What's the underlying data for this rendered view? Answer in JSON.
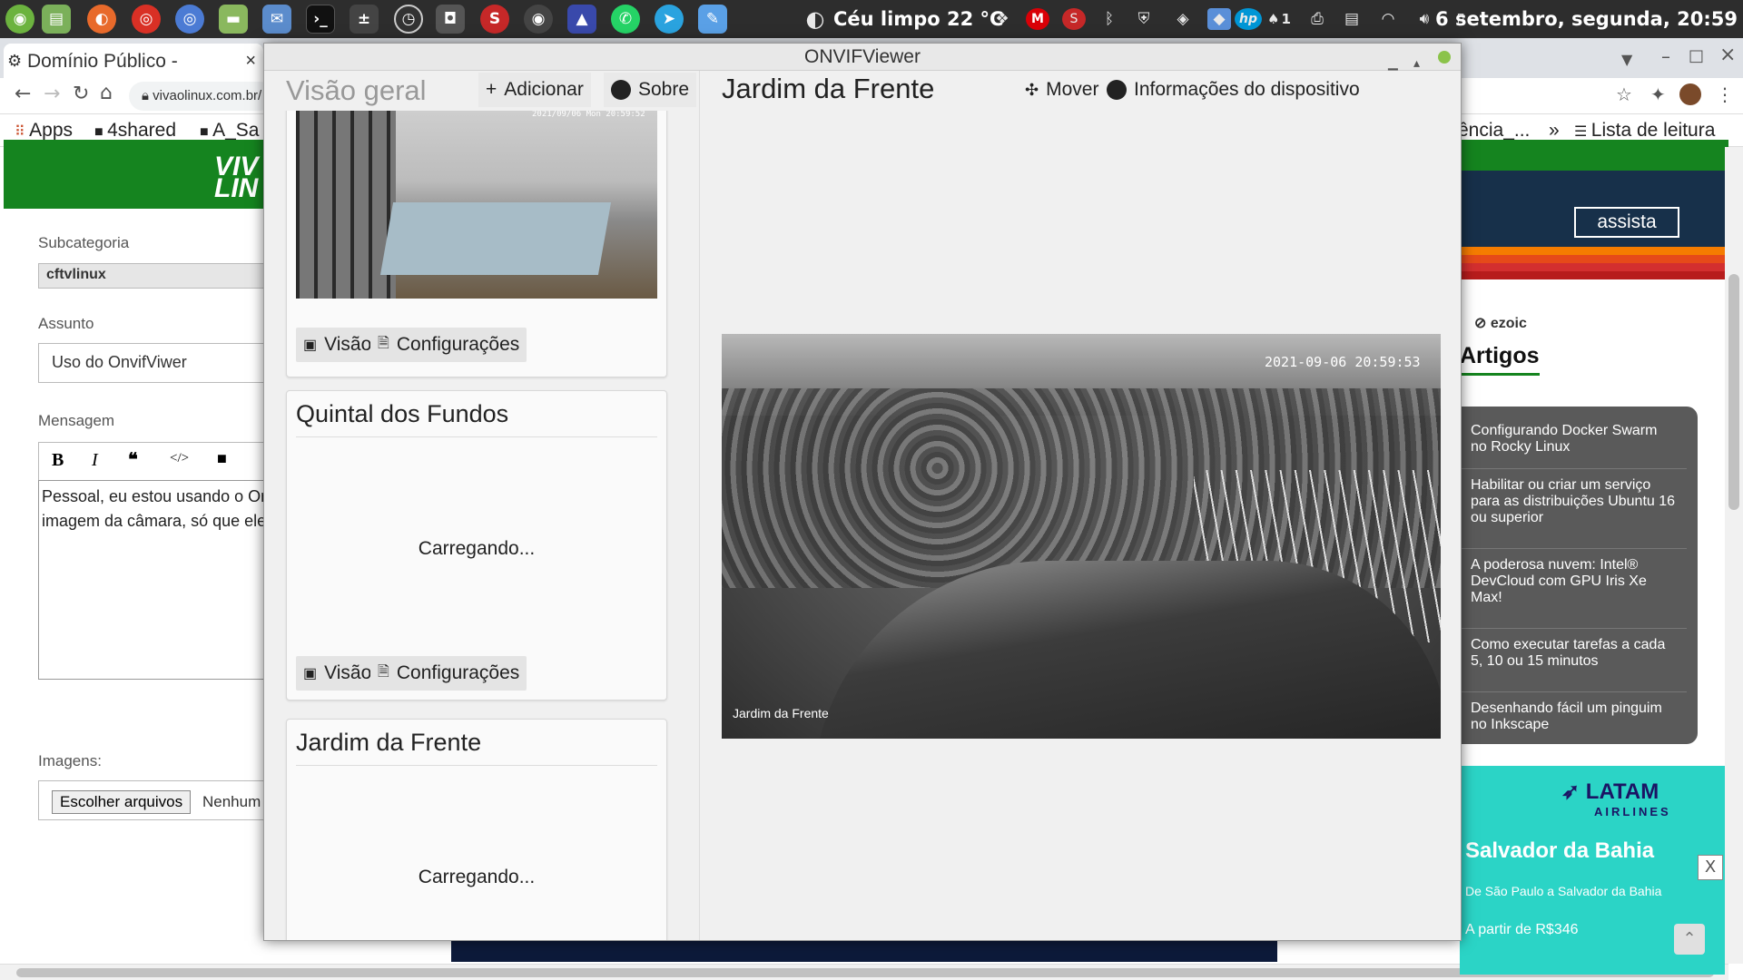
{
  "topbar": {
    "weather": "Céu limpo 22 °C",
    "clock": "6 setembro, segunda, 20:59",
    "tray_badge": "1"
  },
  "browser": {
    "tab1": "Domínio Público -",
    "url": "vivaolinux.com.br/",
    "bookmarks": {
      "apps": "Apps",
      "b1": "4shared",
      "b2": "A_Sa",
      "b3": "ência_...",
      "more": "»",
      "reading": "Lista de leitura"
    },
    "form": {
      "subcat_label": "Subcategoria",
      "subcat_value": "cftvlinux",
      "subject_label": "Assunto",
      "subject_value": "Uso do OnvifViwer",
      "message_label": "Mensagem",
      "message_line1": "Pessoal, eu estou usando o On",
      "message_line2": "imagem da câmara, só que ele",
      "images_label": "Imagens:",
      "choose_files": "Escolher arquivos",
      "no_file": "Nenhum"
    },
    "side": {
      "assista": "assista",
      "ezoic": "ezoic",
      "artigos": "Artigos",
      "items": [
        "Configurando Docker Swarm no Rocky Linux",
        "Habilitar ou criar um serviço para as distribuições Ubuntu 16 ou superior",
        "A poderosa nuvem: Intel® DevCloud com GPU Iris Xe Max!",
        "Como executar tarefas a cada 5, 10 ou 15 minutos",
        "Desenhando fácil um pinguim no Inkscape"
      ],
      "latam": "LATAM",
      "airlines": "AIRLINES",
      "ad_title": "Salvador da Bahia",
      "ad_sub": "De São Paulo a Salvador da Bahia",
      "ad_price": "A partir de R$346",
      "ad_close": "X"
    }
  },
  "onvif": {
    "title": "ONVIFViewer",
    "left_header": "Visão geral",
    "add_btn": "Adicionar",
    "about_btn": "Sobre",
    "right_header": "Jardim da Frente",
    "move_btn": "Mover",
    "info_btn": "Informações do dispositivo",
    "cam1_timestamp": "2021/09/06 Mon 20:59:52",
    "cards": [
      {
        "title": "",
        "view": "Visão",
        "settings": "Configurações"
      },
      {
        "title": "Quintal dos Fundos",
        "loading": "Carregando...",
        "view": "Visão",
        "settings": "Configurações"
      },
      {
        "title": "Jardim da Frente",
        "loading": "Carregando..."
      }
    ],
    "main_timestamp": "2021-09-06 20:59:53",
    "main_label": "Jardim da Frente"
  }
}
